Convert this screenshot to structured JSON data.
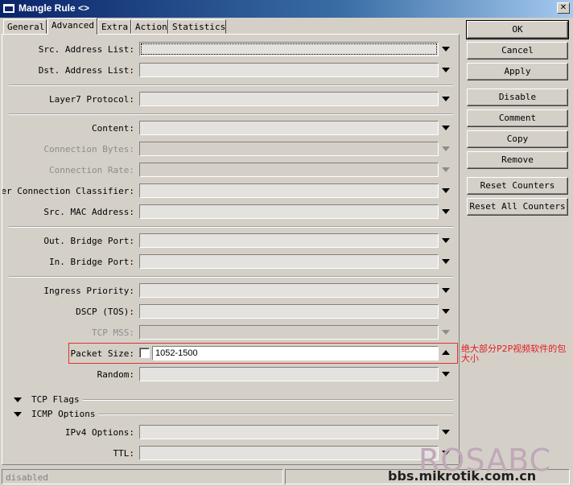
{
  "window": {
    "title": "Mangle Rule <>"
  },
  "tabs": [
    "General",
    "Advanced",
    "Extra",
    "Action",
    "Statistics"
  ],
  "active_tab": "Advanced",
  "fields": {
    "src_address_list": "Src. Address List:",
    "dst_address_list": "Dst. Address List:",
    "layer7_protocol": "Layer7 Protocol:",
    "content": "Content:",
    "connection_bytes": "Connection Bytes:",
    "connection_rate": "Connection Rate:",
    "per_connection_classifier": "Per Connection Classifier:",
    "src_mac_address": "Src. MAC Address:",
    "out_bridge_port": "Out. Bridge Port:",
    "in_bridge_port": "In. Bridge Port:",
    "ingress_priority": "Ingress Priority:",
    "dscp": "DSCP (TOS):",
    "tcp_mss": "TCP MSS:",
    "packet_size": "Packet Size:",
    "random": "Random:",
    "ipv4_options": "IPv4 Options:",
    "ttl": "TTL:"
  },
  "packet_size_value": "1052-1500",
  "sections": {
    "tcp_flags": "TCP Flags",
    "icmp_options": "ICMP Options"
  },
  "buttons": {
    "ok": "OK",
    "cancel": "Cancel",
    "apply": "Apply",
    "disable": "Disable",
    "comment": "Comment",
    "copy": "Copy",
    "remove": "Remove",
    "reset_counters": "Reset Counters",
    "reset_all_counters": "Reset All Counters"
  },
  "annotation": "绝大部分P2P视频软件的包大小",
  "status": "disabled",
  "watermark": {
    "brand": "ROSABC",
    "site": "bbs.mikrotik.com.cn"
  },
  "icons": {
    "dropdown": "triangle-down-icon",
    "collapse": "triangle-down-icon",
    "close": "close-icon"
  }
}
